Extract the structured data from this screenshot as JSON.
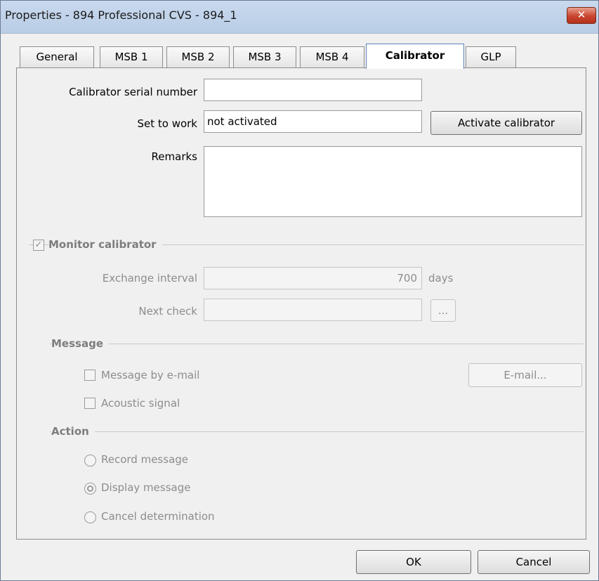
{
  "window": {
    "title": "Properties - 894 Professional CVS - 894_1",
    "close_symbol": "✕"
  },
  "tabs": [
    {
      "label": "General"
    },
    {
      "label": "MSB 1"
    },
    {
      "label": "MSB 2"
    },
    {
      "label": "MSB 3"
    },
    {
      "label": "MSB 4"
    },
    {
      "label": "Calibrator",
      "active": true
    },
    {
      "label": "GLP"
    }
  ],
  "calibrator": {
    "serial_label": "Calibrator serial number",
    "serial_value": "",
    "set_to_work_label": "Set to work",
    "set_to_work_value": "not activated",
    "activate_button": "Activate calibrator",
    "remarks_label": "Remarks",
    "remarks_value": ""
  },
  "monitor": {
    "checkbox_label": "Monitor calibrator",
    "checked": true,
    "exchange_interval_label": "Exchange interval",
    "exchange_interval_value": "700",
    "exchange_interval_unit": "days",
    "next_check_label": "Next check",
    "next_check_value": "",
    "browse_button": "..."
  },
  "message": {
    "title": "Message",
    "by_email_label": "Message by e-mail",
    "by_email_checked": false,
    "email_button": "E-mail...",
    "acoustic_label": "Acoustic signal",
    "acoustic_checked": false
  },
  "action": {
    "title": "Action",
    "options": [
      {
        "label": "Record message",
        "selected": false
      },
      {
        "label": "Display message",
        "selected": true
      },
      {
        "label": "Cancel determination",
        "selected": false
      }
    ]
  },
  "footer": {
    "ok": "OK",
    "cancel": "Cancel"
  }
}
